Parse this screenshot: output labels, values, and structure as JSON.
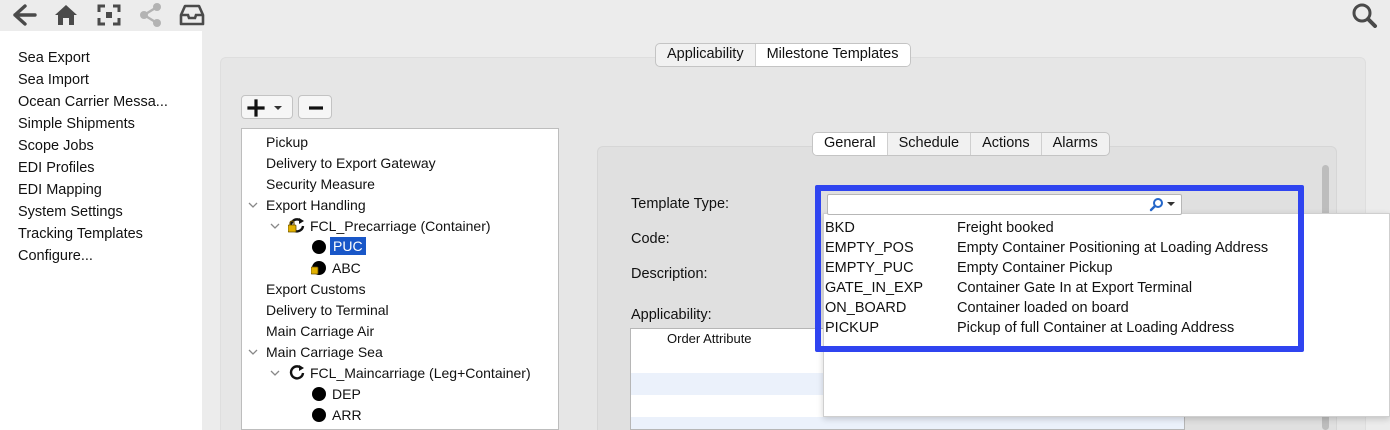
{
  "toolbar": {
    "icons": [
      "back-arrow-icon",
      "home-icon",
      "expand-icon",
      "share-icon",
      "inbox-icon",
      "search-icon"
    ]
  },
  "sidebar": {
    "items": [
      {
        "label": "Sea Export"
      },
      {
        "label": "Sea Import"
      },
      {
        "label": "Ocean Carrier Messa..."
      },
      {
        "label": "Simple Shipments"
      },
      {
        "label": "Scope Jobs"
      },
      {
        "label": "EDI Profiles"
      },
      {
        "label": "EDI Mapping"
      },
      {
        "label": "System Settings"
      },
      {
        "label": "Tracking Templates"
      },
      {
        "label": "Configure..."
      }
    ]
  },
  "top_tabs": {
    "applicability": "Applicability",
    "milestone_templates": "Milestone Templates",
    "active": "Milestone Templates"
  },
  "tree": {
    "items": [
      {
        "label": "Pickup"
      },
      {
        "label": "Delivery to Export Gateway"
      },
      {
        "label": "Security Measure"
      },
      {
        "label": "Export Handling"
      },
      {
        "label": "FCL_Precarriage (Container)"
      },
      {
        "label": "PUC"
      },
      {
        "label": "ABC"
      },
      {
        "label": "Export Customs"
      },
      {
        "label": "Delivery to Terminal"
      },
      {
        "label": "Main Carriage Air"
      },
      {
        "label": "Main Carriage Sea"
      },
      {
        "label": "FCL_Maincarriage (Leg+Container)"
      },
      {
        "label": "DEP"
      },
      {
        "label": "ARR"
      }
    ],
    "selected": "PUC"
  },
  "detail_tabs": {
    "general": "General",
    "schedule": "Schedule",
    "actions": "Actions",
    "alarms": "Alarms",
    "active": "General"
  },
  "form": {
    "template_type_label": "Template Type:",
    "template_type_value": "",
    "code_label": "Code:",
    "description_label": "Description:",
    "applicability_label": "Applicability:",
    "order_attribute_header": "Order Attribute"
  },
  "dropdown": {
    "options": [
      {
        "code": "BKD",
        "description": "Freight booked"
      },
      {
        "code": "EMPTY_POS",
        "description": "Empty Container Positioning at Loading Address"
      },
      {
        "code": "EMPTY_PUC",
        "description": "Empty Container Pickup"
      },
      {
        "code": "GATE_IN_EXP",
        "description": "Container Gate In at Export Terminal"
      },
      {
        "code": "ON_BOARD",
        "description": "Container loaded on board"
      },
      {
        "code": "PICKUP",
        "description": "Pickup of full Container at Loading Address"
      }
    ]
  },
  "colors": {
    "highlight": "#2f44f0",
    "selection": "#1957c8",
    "search_icon": "#2466c9"
  }
}
